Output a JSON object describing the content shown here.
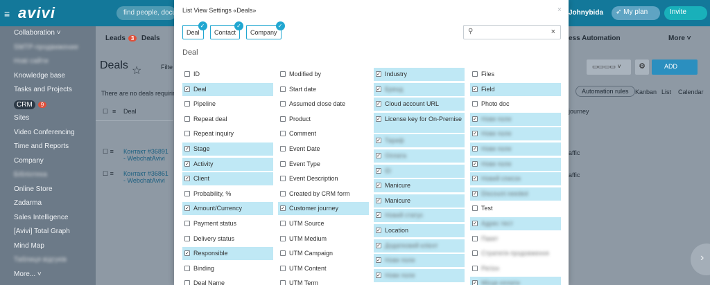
{
  "app": {
    "logo": "avivi",
    "search_placeholder": "find people, documents",
    "user": "Johnybida",
    "my_plan": "My plan",
    "invite": "Invite"
  },
  "sidebar": {
    "items": [
      {
        "label": "Collaboration ˅",
        "blur": false
      },
      {
        "label": "SMTP-продвижение",
        "blur": true
      },
      {
        "label": "Нові сайти",
        "blur": true
      },
      {
        "label": "Knowledge base",
        "blur": false
      },
      {
        "label": "Tasks and Projects",
        "blur": false
      },
      {
        "label": "CRM",
        "blur": false,
        "badge": "9"
      },
      {
        "label": "Sites",
        "blur": false
      },
      {
        "label": "Video Conferencing",
        "blur": false
      },
      {
        "label": "Time and Reports",
        "blur": false
      },
      {
        "label": "Company",
        "blur": false
      },
      {
        "label": "Бібліотека",
        "blur": true
      },
      {
        "label": "Online Store",
        "blur": false
      },
      {
        "label": "Zadarma",
        "blur": false
      },
      {
        "label": "Sales Intelligence",
        "blur": false
      },
      {
        "label": "[Avivi] Total Graph",
        "blur": false
      },
      {
        "label": "Mind Map",
        "blur": false
      },
      {
        "label": "Таблиця відгуків",
        "blur": true
      },
      {
        "label": "More... ˅",
        "blur": false
      }
    ]
  },
  "content": {
    "tab_leads": "Leads",
    "tab_leads_badge": "3",
    "tab_deals": "Deals",
    "page_title": "Deals",
    "filter_text": "Filte",
    "no_deals_text": "There are no deals requiring",
    "deal_column": "Deal",
    "process_automation": "ess Automation",
    "more": "More ˅",
    "add": "ADD",
    "automation_rules": "Automation rules",
    "kanban": "Kanban",
    "list": "List",
    "calendar": "Calendar",
    "journey_col": "journey",
    "traffic_1": "affic",
    "traffic_2": "affic",
    "row_1": "Контакт #36891 - WebchatAvivi",
    "row_2": "Контакт #36861 - WebchatAvivi"
  },
  "modal": {
    "title": "List View Settings «Deals»",
    "close": "×",
    "tabs": [
      "Deal",
      "Contact",
      "Company"
    ],
    "section_title": "Deal",
    "search_value": "",
    "columns": [
      [
        {
          "label": "ID",
          "checked": false
        },
        {
          "label": "Deal",
          "checked": true
        },
        {
          "label": "Pipeline",
          "checked": false
        },
        {
          "label": "Repeat deal",
          "checked": false
        },
        {
          "label": "Repeat inquiry",
          "checked": false
        },
        {
          "label": "Stage",
          "checked": true
        },
        {
          "label": "Activity",
          "checked": true
        },
        {
          "label": "Client",
          "checked": true
        },
        {
          "label": "Probability, %",
          "checked": false
        },
        {
          "label": "Amount/Currency",
          "checked": true
        },
        {
          "label": "Payment status",
          "checked": false
        },
        {
          "label": "Delivery status",
          "checked": false
        },
        {
          "label": "Responsible",
          "checked": true
        },
        {
          "label": "Binding",
          "checked": false
        },
        {
          "label": "Deal Name",
          "checked": false
        }
      ],
      [
        {
          "label": "Modified by",
          "checked": false
        },
        {
          "label": "Start date",
          "checked": false
        },
        {
          "label": "Assumed close date",
          "checked": false
        },
        {
          "label": "Product",
          "checked": false
        },
        {
          "label": "Comment",
          "checked": false
        },
        {
          "label": "Event Date",
          "checked": false
        },
        {
          "label": "Event Type",
          "checked": false
        },
        {
          "label": "Event Description",
          "checked": false
        },
        {
          "label": "Created by CRM form",
          "checked": false
        },
        {
          "label": "Customer journey",
          "checked": true
        },
        {
          "label": "UTM Source",
          "checked": false
        },
        {
          "label": "UTM Medium",
          "checked": false
        },
        {
          "label": "UTM Campaign",
          "checked": false
        },
        {
          "label": "UTM Content",
          "checked": false
        },
        {
          "label": "UTM Term",
          "checked": false
        }
      ],
      [
        {
          "label": "Industry",
          "checked": true
        },
        {
          "label": "Бренд",
          "checked": true,
          "blur": true
        },
        {
          "label": "Cloud account URL",
          "checked": true
        },
        {
          "label": "License key for On-Premise",
          "checked": true,
          "tall": true
        },
        {
          "label": "Тариф",
          "checked": true,
          "blur": true
        },
        {
          "label": "Оплата",
          "checked": true,
          "blur": true
        },
        {
          "label": "ID",
          "checked": true,
          "blur": true
        },
        {
          "label": "Manicure",
          "checked": true
        },
        {
          "label": "Manicure",
          "checked": true
        },
        {
          "label": "Новий статус",
          "checked": true,
          "blur": true
        },
        {
          "label": "Location",
          "checked": true
        },
        {
          "label": "Додатковий клієнт",
          "checked": true,
          "blur": true
        },
        {
          "label": "Нове поле",
          "checked": true,
          "blur": true
        },
        {
          "label": "Нове поле",
          "checked": true,
          "blur": true
        }
      ],
      [
        {
          "label": "Files",
          "checked": false
        },
        {
          "label": "Field",
          "checked": true
        },
        {
          "label": "Photo doc",
          "checked": false
        },
        {
          "label": "Нове поле",
          "checked": true,
          "blur": true
        },
        {
          "label": "Нове поле",
          "checked": true,
          "blur": true
        },
        {
          "label": "Нове поле",
          "checked": true,
          "blur": true
        },
        {
          "label": "Нове поле",
          "checked": true,
          "blur": true
        },
        {
          "label": "Новий список",
          "checked": true,
          "blur": true
        },
        {
          "label": "Discount needed",
          "checked": true,
          "blur": true
        },
        {
          "label": "Test",
          "checked": false
        },
        {
          "label": "Адрес тест",
          "checked": true,
          "blur": true
        },
        {
          "label": "Пакет",
          "checked": false,
          "blur": true
        },
        {
          "label": "Стратегія продовження",
          "checked": false,
          "blur": true
        },
        {
          "label": "Регіон",
          "checked": false,
          "blur": true
        },
        {
          "label": "Місце оплати",
          "checked": true,
          "blur": true
        }
      ]
    ]
  }
}
